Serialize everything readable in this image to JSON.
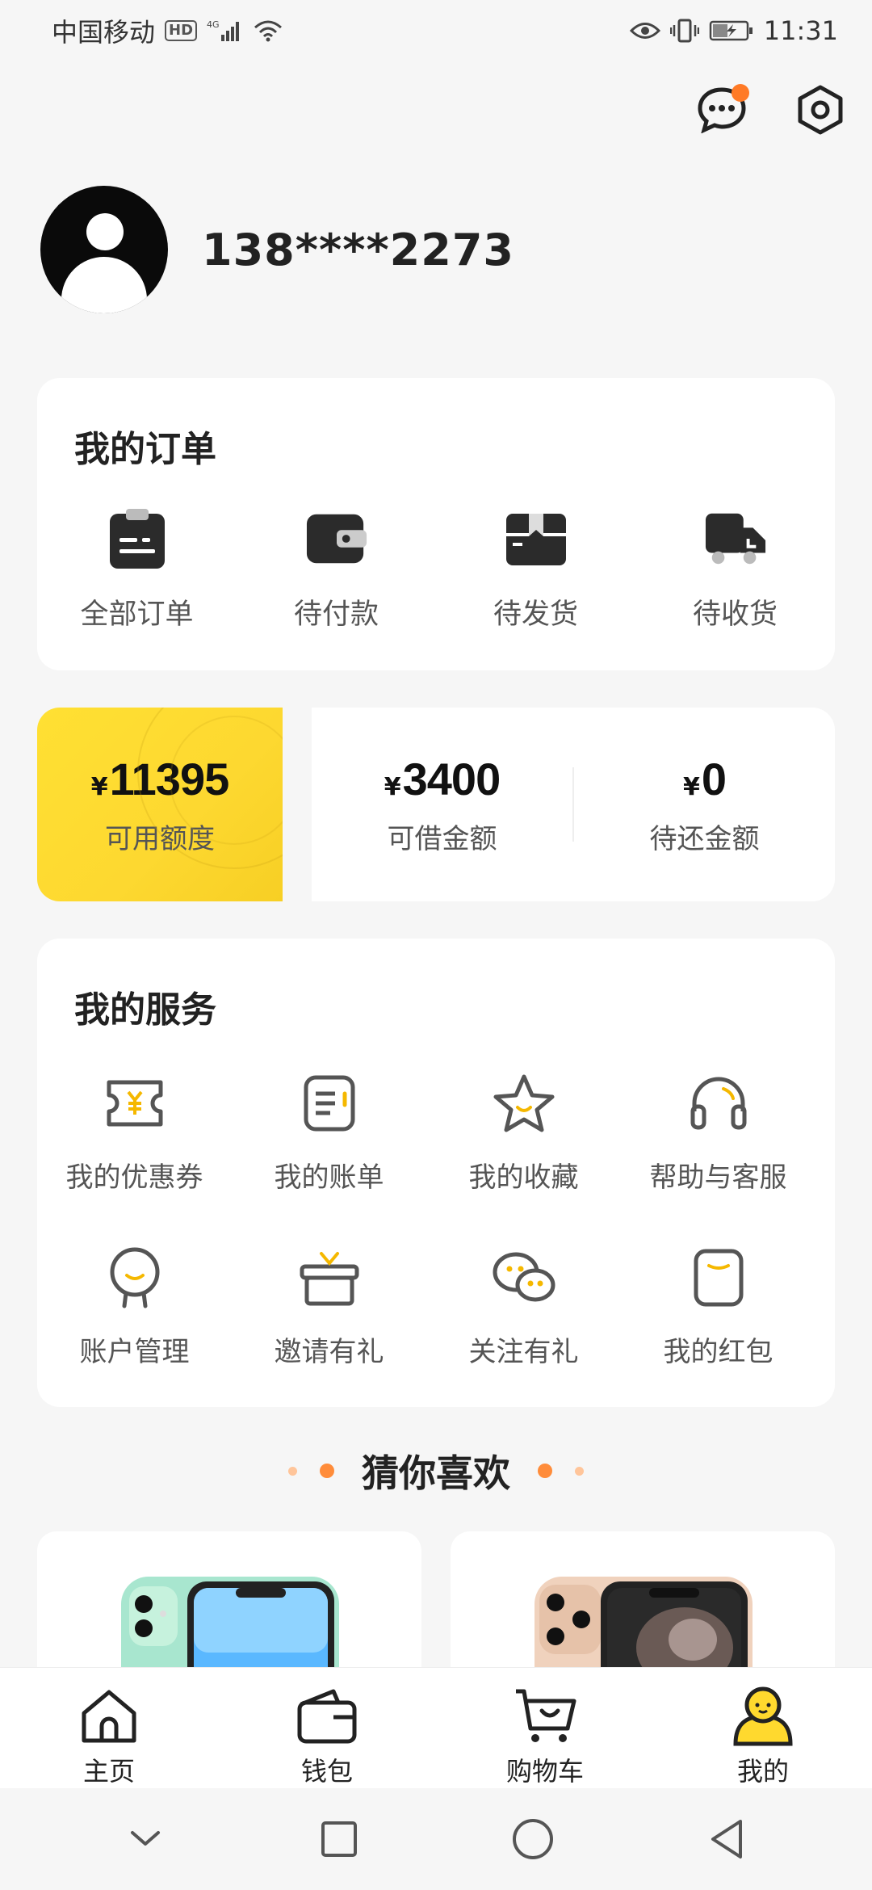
{
  "status_bar": {
    "carrier": "中国移动",
    "hd": "HD",
    "network": "4G",
    "time": "11:31"
  },
  "profile": {
    "phone": "138****2273"
  },
  "orders": {
    "title": "我的订单",
    "items": [
      {
        "label": "全部订单",
        "icon": "clipboard-icon"
      },
      {
        "label": "待付款",
        "icon": "wallet-icon"
      },
      {
        "label": "待发货",
        "icon": "package-icon"
      },
      {
        "label": "待收货",
        "icon": "truck-icon"
      }
    ]
  },
  "credit": {
    "currency": "¥",
    "available": {
      "value": "11395",
      "label": "可用额度"
    },
    "borrowable": {
      "value": "3400",
      "label": "可借金额"
    },
    "repay": {
      "value": "0",
      "label": "待还金额"
    }
  },
  "services": {
    "title": "我的服务",
    "items": [
      {
        "label": "我的优惠券",
        "icon": "coupon-icon"
      },
      {
        "label": "我的账单",
        "icon": "bill-icon"
      },
      {
        "label": "我的收藏",
        "icon": "star-icon"
      },
      {
        "label": "帮助与客服",
        "icon": "headset-icon"
      },
      {
        "label": "账户管理",
        "icon": "account-icon"
      },
      {
        "label": "邀请有礼",
        "icon": "gift-icon"
      },
      {
        "label": "关注有礼",
        "icon": "wechat-icon"
      },
      {
        "label": "我的红包",
        "icon": "red-packet-icon"
      }
    ]
  },
  "recommend": {
    "title": "猜你喜欢"
  },
  "bottom_nav": {
    "items": [
      {
        "label": "主页",
        "icon": "home-icon"
      },
      {
        "label": "钱包",
        "icon": "wallet-icon"
      },
      {
        "label": "购物车",
        "icon": "cart-icon"
      },
      {
        "label": "我的",
        "icon": "profile-icon",
        "active": true
      }
    ]
  },
  "colors": {
    "accent": "#FFD92E",
    "badge": "#FF7A26",
    "icon_dark": "#2b2b2b",
    "icon_gray": "#555555"
  }
}
